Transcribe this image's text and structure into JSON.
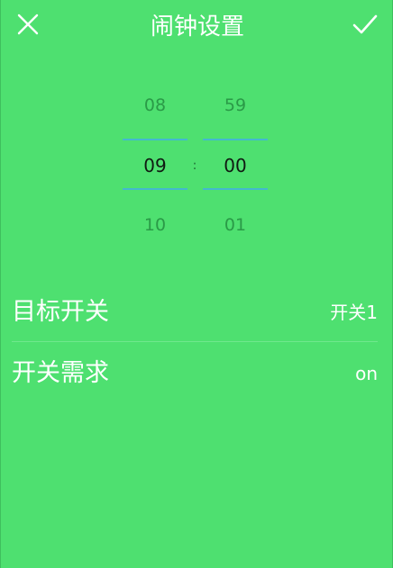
{
  "header": {
    "title": "闹钟设置",
    "close_icon": "close-icon",
    "confirm_icon": "check-icon"
  },
  "time_picker": {
    "hours": {
      "prev": "08",
      "selected": "09",
      "next": "10"
    },
    "minutes": {
      "prev": "59",
      "selected": "00",
      "next": "01"
    },
    "separator": ":",
    "accent_color": "#43b8cf"
  },
  "settings": [
    {
      "label": "目标开关",
      "value": "开关1"
    },
    {
      "label": "开关需求",
      "value": "on"
    }
  ],
  "colors": {
    "background": "#4ee070",
    "text": "#ffffff",
    "dim_text": "#2a9a47"
  }
}
